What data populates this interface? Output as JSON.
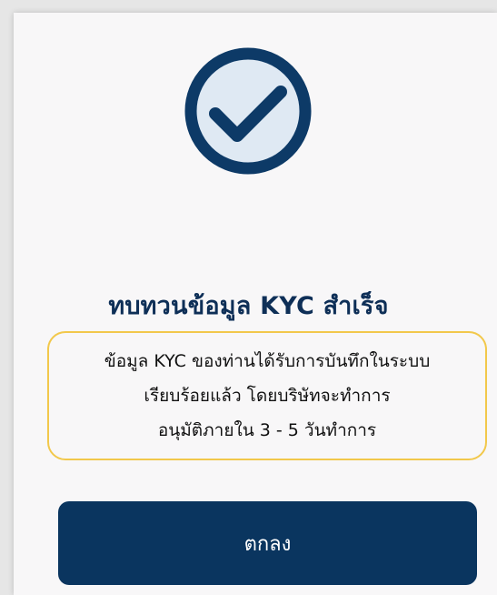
{
  "dialog": {
    "icon": "check-circle-icon",
    "title": "ทบทวนข้อมูล KYC สำเร็จ",
    "message_lines": [
      "ข้อมูล KYC ของท่านได้รับการบันทึกในระบบ",
      "เรียบร้อยแล้ว โดยบริษัทจะทำการ",
      "อนุมัติภายใน 3 - 5 วันทำการ"
    ],
    "button_label": "ตกลง"
  },
  "colors": {
    "primary": "#0a355f",
    "icon_fill": "#dfe9f3",
    "message_border": "#f2c84b",
    "background": "#f8f7f8"
  }
}
